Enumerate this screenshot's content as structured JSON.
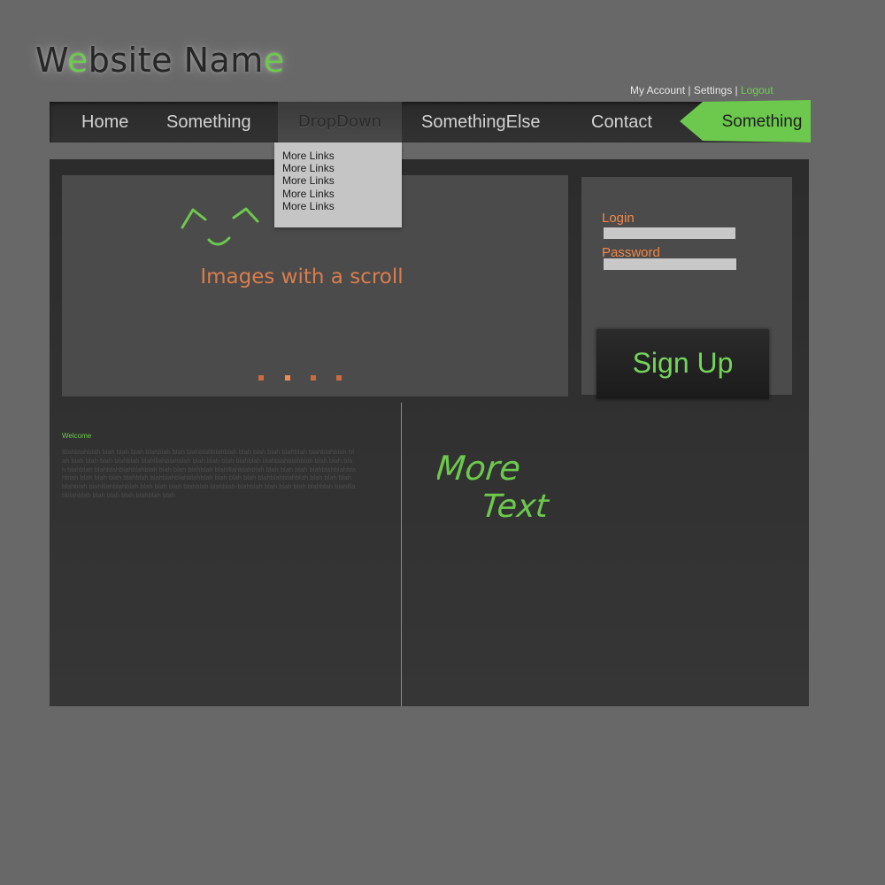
{
  "header": {
    "title_parts": [
      "W",
      "e",
      "bsite Nam",
      "e"
    ],
    "accent_color": "#6cc94d"
  },
  "account": {
    "my_account": "My Account",
    "separator": " | ",
    "settings": "Settings",
    "logout": "Logout"
  },
  "nav": {
    "items": [
      {
        "label": "Home"
      },
      {
        "label": "Something"
      },
      {
        "label": "DropDown"
      },
      {
        "label": "SomethingElse"
      },
      {
        "label": "Contact"
      }
    ],
    "cta": {
      "label": "Something",
      "color": "#6cc94d",
      "icon": "arrow-left-shape"
    }
  },
  "dropdown": {
    "links": [
      "More Links",
      "More Links",
      "More Links",
      "More Links",
      "More Links"
    ]
  },
  "slider": {
    "caption": "Images with a scroll",
    "dot_count": 4,
    "active_dot": 2,
    "dot_color": "#c96b3f"
  },
  "login_panel": {
    "login_label": "Login",
    "password_label": "Password",
    "login_value": "",
    "password_value": "",
    "signup_label": "Sign Up"
  },
  "welcome": {
    "heading": "Welcome",
    "body": "Blahblahblah blah blah blah blahblah blah blahblahblahblah blah blah blah blahblah blahblahblah-blah blah blah blah blahblah blahlllahblahblah blah blah blah blahblah blahblahblahblah blah blah blah blahblah blahblahblahblahblah blah blah blahblah blahlllahblahblah blah blah blah blahblahblahblahblah blah blah blah blahblah blahblahblahblahblah blah blah blah blahblahblahblah blah blah blah blahblah blahlllahblahblah blah blah blah blahblah blahblah-blahblah blah blah blah blahblah blahlllahblahblah blah blah blah blahblah blah",
    "handwritten_line1": "More",
    "handwritten_line2": "Text"
  }
}
